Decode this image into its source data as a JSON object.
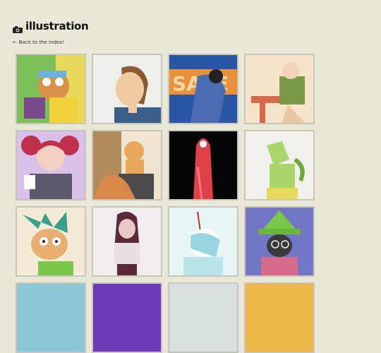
{
  "header": {
    "icon": "camera-icon",
    "title": "illustration"
  },
  "nav": {
    "back_label": "Back to the index!",
    "back_icon": "arrow-left-icon"
  },
  "gallery": {
    "items": [
      {
        "name": "thumbnail-1"
      },
      {
        "name": "thumbnail-2"
      },
      {
        "name": "thumbnail-3"
      },
      {
        "name": "thumbnail-4"
      },
      {
        "name": "thumbnail-5"
      },
      {
        "name": "thumbnail-6"
      },
      {
        "name": "thumbnail-7"
      },
      {
        "name": "thumbnail-8"
      },
      {
        "name": "thumbnail-9"
      },
      {
        "name": "thumbnail-10"
      },
      {
        "name": "thumbnail-11"
      },
      {
        "name": "thumbnail-12"
      },
      {
        "name": "thumbnail-13"
      },
      {
        "name": "thumbnail-14"
      },
      {
        "name": "thumbnail-15"
      },
      {
        "name": "thumbnail-16"
      }
    ]
  },
  "colors": {
    "background": "#e9e8d9",
    "tile_border": "#c7c6b8"
  }
}
